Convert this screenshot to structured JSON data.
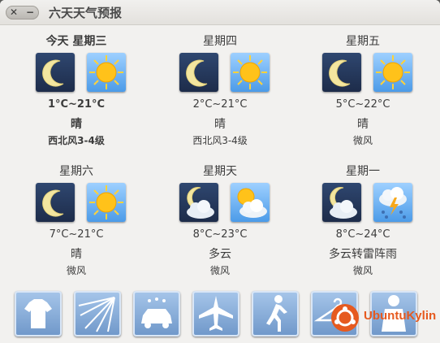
{
  "window": {
    "title": "六天天气预报",
    "close_glyph": "✕",
    "min_glyph": "−"
  },
  "days": [
    {
      "name": "今天  星期三",
      "temp": "1°C~21°C",
      "cond": "晴",
      "wind": "西北风3-4级",
      "icon_left": "moon-icon",
      "icon_right": "sun-icon"
    },
    {
      "name": "星期四",
      "temp": "2°C~21°C",
      "cond": "晴",
      "wind": "西北风3-4级",
      "icon_left": "moon-icon",
      "icon_right": "sun-icon"
    },
    {
      "name": "星期五",
      "temp": "5°C~22°C",
      "cond": "晴",
      "wind": "微风",
      "icon_left": "moon-icon",
      "icon_right": "sun-icon"
    },
    {
      "name": "星期六",
      "temp": "7°C~21°C",
      "cond": "晴",
      "wind": "微风",
      "icon_left": "moon-icon",
      "icon_right": "sun-icon"
    },
    {
      "name": "星期天",
      "temp": "8°C~23°C",
      "cond": "多云",
      "wind": "微风",
      "icon_left": "moon-cloud-icon",
      "icon_right": "sun-cloud-icon"
    },
    {
      "name": "星期一",
      "temp": "8°C~24°C",
      "cond": "多云转雷阵雨",
      "wind": "微风",
      "icon_left": "moon-cloud-icon",
      "icon_right": "thunder-rain-icon"
    }
  ],
  "life_icons": [
    "clothing-icon",
    "sunshade-icon",
    "car-wash-icon",
    "travel-plane-icon",
    "exercise-running-icon",
    "drying-hanger-icon",
    "cold-icon"
  ],
  "logo": {
    "text": "UbuntuKylin"
  },
  "colors": {
    "night_bg": "#2f4770",
    "sky_bg": "#4c9be8",
    "life_bg": "#8fb3df",
    "brand": "#e65a1f"
  }
}
